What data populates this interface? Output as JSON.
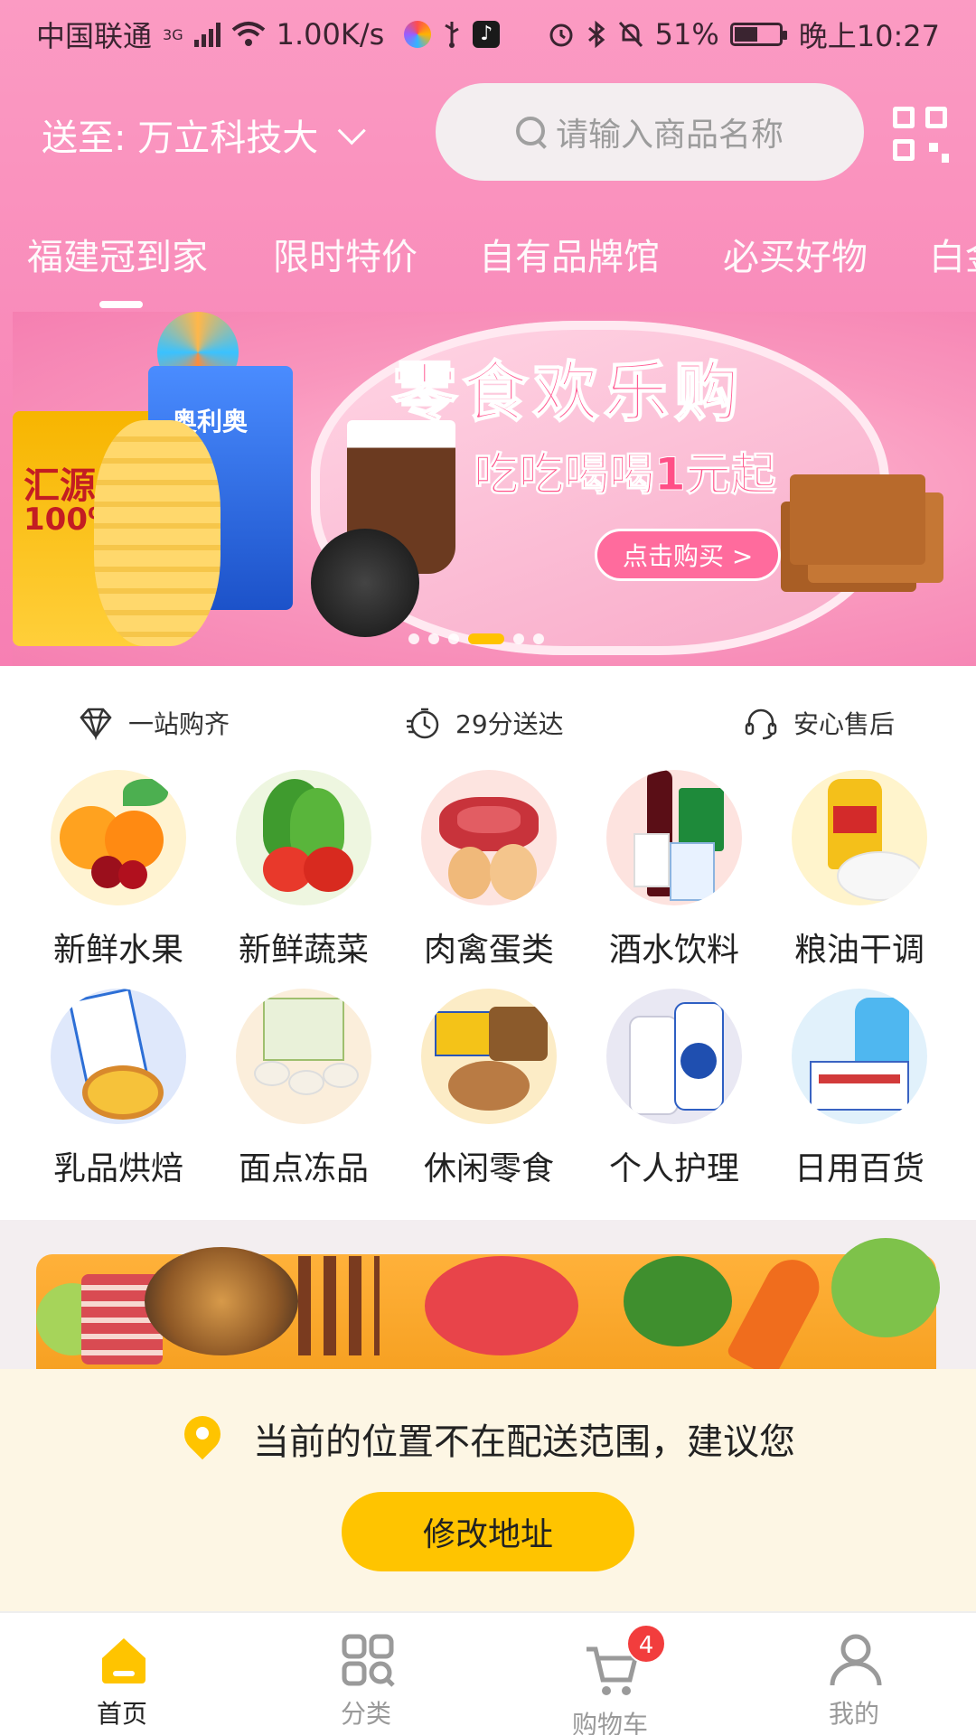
{
  "status_bar": {
    "carrier": "中国联通",
    "network": "3G",
    "speed": "1.00K/s",
    "battery": "51%",
    "time": "晚上10:27"
  },
  "header": {
    "address_prefix": "送至:",
    "address": "万立科技大",
    "search_placeholder": "请输入商品名称"
  },
  "tabs": [
    "福建冠到家",
    "限时特价",
    "自有品牌馆",
    "必买好物",
    "白金"
  ],
  "banner": {
    "headline": "零食欢乐购",
    "subline": "吃吃喝喝1元起",
    "cta": "点击购买 >",
    "juice_brand": "汇源",
    "juice_label": "100%",
    "oreo_brand": "奥利奥",
    "dot_count": 6,
    "active_dot": 3
  },
  "features": [
    {
      "icon": "diamond-icon",
      "label": "一站购齐"
    },
    {
      "icon": "stopwatch-icon",
      "label": "29分送达"
    },
    {
      "icon": "headset-icon",
      "label": "安心售后"
    }
  ],
  "categories": [
    {
      "label": "新鲜水果",
      "icon": "fruit-image"
    },
    {
      "label": "新鲜蔬菜",
      "icon": "vegetable-image"
    },
    {
      "label": "肉禽蛋类",
      "icon": "meat-egg-image"
    },
    {
      "label": "酒水饮料",
      "icon": "drinks-image"
    },
    {
      "label": "粮油干调",
      "icon": "grain-oil-image"
    },
    {
      "label": "乳品烘焙",
      "icon": "dairy-bakery-image"
    },
    {
      "label": "面点冻品",
      "icon": "frozen-food-image"
    },
    {
      "label": "休闲零食",
      "icon": "snacks-image"
    },
    {
      "label": "个人护理",
      "icon": "personal-care-image"
    },
    {
      "label": "日用百货",
      "icon": "daily-goods-image"
    }
  ],
  "notice": {
    "message": "当前的位置不在配送范围，建议您",
    "button": "修改地址"
  },
  "bottom_nav": [
    {
      "label": "首页",
      "icon": "home-icon",
      "active": true
    },
    {
      "label": "分类",
      "icon": "category-icon",
      "active": false
    },
    {
      "label": "购物车",
      "icon": "cart-icon",
      "active": false,
      "badge": "4"
    },
    {
      "label": "我的",
      "icon": "user-icon",
      "active": false
    }
  ],
  "colors": {
    "hero_pink": "#f98dbb",
    "accent_yellow": "#ffc400",
    "badge_red": "#f23d3d",
    "notice_bg": "#fdf6e4"
  }
}
